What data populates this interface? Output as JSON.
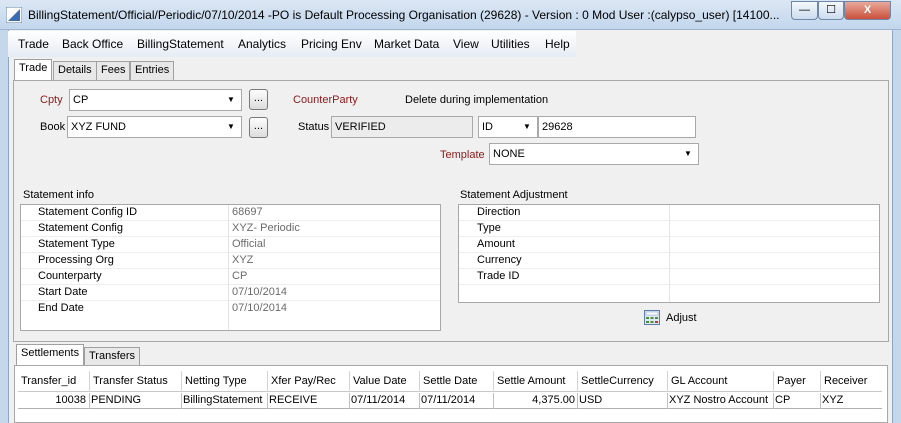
{
  "window": {
    "title": "BillingStatement/Official/Periodic/07/10/2014  -PO is Default Processing Organisation  (29628) - Version : 0 Mod User :(calypso_user)  [14100...",
    "min_glyph": "—",
    "max_glyph": "☐",
    "close_glyph": "X"
  },
  "menu": [
    "Trade",
    "Back Office",
    "BillingStatement",
    "Analytics",
    "Pricing Env",
    "Market Data",
    "View",
    "Utilities",
    "Help"
  ],
  "tabs": [
    "Trade",
    "Details",
    "Fees",
    "Entries"
  ],
  "form": {
    "cpty_label": "Cpty",
    "cpty_value": "CP",
    "book_label": "Book",
    "book_value": "XYZ FUND",
    "dots": "...",
    "counterparty_label": "CounterParty",
    "counterparty_note": "Delete during implementation",
    "status_label": "Status",
    "status_value": "VERIFIED",
    "id_type": "ID",
    "id_value": "29628",
    "template_label": "Template",
    "template_value": "NONE"
  },
  "statement_info": {
    "title": "Statement info",
    "rows": [
      {
        "key": "Statement Config ID",
        "value": "68697"
      },
      {
        "key": "Statement Config",
        "value": "XYZ- Periodic"
      },
      {
        "key": "Statement Type",
        "value": "Official"
      },
      {
        "key": "Processing Org",
        "value": "XYZ"
      },
      {
        "key": "Counterparty",
        "value": "CP"
      },
      {
        "key": "Start Date",
        "value": "07/10/2014"
      },
      {
        "key": "End Date",
        "value": "07/10/2014"
      }
    ]
  },
  "statement_adjustment": {
    "title": "Statement Adjustment",
    "rows": [
      "Direction",
      "Type",
      "Amount",
      "Currency",
      "Trade ID"
    ],
    "adjust_label": "Adjust"
  },
  "bottom_tabs": [
    "Settlements",
    "Transfers"
  ],
  "settlements": {
    "columns": [
      "Transfer_id",
      "Transfer Status",
      "Netting Type",
      "Xfer Pay/Rec",
      "Value Date",
      "Settle Date",
      "Settle Amount",
      "SettleCurrency",
      "GL Account",
      "Payer",
      "Receiver"
    ],
    "rows": [
      [
        "10038",
        "PENDING",
        "BillingStatement",
        "RECEIVE",
        "07/11/2014",
        "07/11/2014",
        "4,375.00",
        "USD",
        "XYZ Nostro Account",
        "CP",
        "XYZ"
      ]
    ]
  },
  "colors": {
    "accent": "#c5d7ea",
    "label_red": "#8b1a1a",
    "readonly_text": "#6b6b6b"
  }
}
